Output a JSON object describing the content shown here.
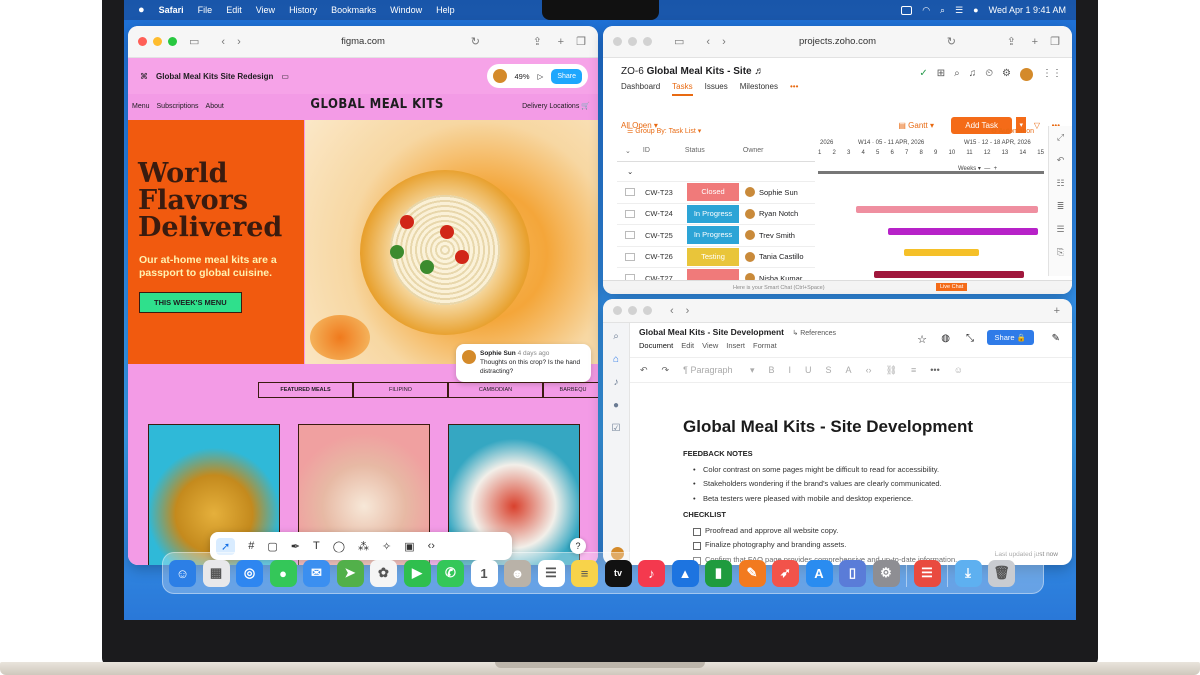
{
  "menubar": {
    "apple": "",
    "items": [
      "Safari",
      "File",
      "Edit",
      "View",
      "History",
      "Bookmarks",
      "Window",
      "Help"
    ],
    "datetime": "Wed Apr 1  9:41 AM"
  },
  "figma": {
    "url": "figma.com",
    "project": "Global Meal Kits Site Redesign",
    "zoom": "49%",
    "share": "Share",
    "site": {
      "nav": [
        "Menu",
        "Subscriptions",
        "About"
      ],
      "logo": "GLOBAL MEAL KITS",
      "delivery": "Delivery Locations",
      "hero_title": "World Flavors Delivered",
      "hero_sub": "Our at-home meal kits are a passport to global cuisine.",
      "cta": "THIS WEEK'S MENU",
      "featured": [
        "FEATURED MEALS",
        "FILIPINO",
        "CAMBODIAN",
        "BARBEQU"
      ]
    },
    "comment": {
      "author": "Sophie Sun",
      "time": "4 days ago",
      "text": "Thoughts on this crop? Is the hand distracting?"
    },
    "help": "?"
  },
  "zoho": {
    "url": "projects.zoho.com",
    "code": "ZO-6",
    "title": "Global Meal Kits - Site",
    "tabs": [
      "Dashboard",
      "Tasks",
      "Issues",
      "Milestones",
      "•••"
    ],
    "filter": "All Open",
    "view": "Gantt",
    "add_task": "Add Task",
    "group_by": "Group By: Task List",
    "automation": "Automation",
    "columns": [
      "ID",
      "Status",
      "Owner"
    ],
    "gantt_header": {
      "year": "2026",
      "w14": "W14 · 05 - 11 APR, 2026",
      "w15": "W15 · 12 - 18 APR, 2026",
      "days": [
        "1",
        "2",
        "3",
        "4",
        "5",
        "6",
        "7",
        "8",
        "9",
        "10",
        "11",
        "12",
        "13",
        "14",
        "15"
      ],
      "scale": "Weeks"
    },
    "rows": [
      {
        "id": "CW-T23",
        "status": "Closed",
        "status_color": "#f07a7a",
        "owner": "Sophie Sun",
        "bar_color": "#ef8fa0"
      },
      {
        "id": "CW-T24",
        "status": "In Progress",
        "status_color": "#2ca4d6",
        "owner": "Ryan Notch",
        "bar_color": "#b722c8"
      },
      {
        "id": "CW-T25",
        "status": "In Progress",
        "status_color": "#2ca4d6",
        "owner": "Trev Smith",
        "bar_color": "#f5c028"
      },
      {
        "id": "CW-T26",
        "status": "Testing",
        "status_color": "#e9c53a",
        "owner": "Tania Castillo",
        "bar_color": "#a0173c"
      },
      {
        "id": "CW-T27",
        "status": "",
        "status_color": "#f07a7a",
        "owner": "Nisha Kumar",
        "bar_color": "#e86a12"
      }
    ],
    "footer_chat": "Here is your Smart Chat (Ctrl+Space)",
    "live_chat": "Live Chat"
  },
  "doc": {
    "title_bar": "Global Meal Kits - Site Development",
    "references": "References",
    "menu": [
      "Document",
      "Edit",
      "View",
      "Insert",
      "Format"
    ],
    "share": "Share",
    "paragraph": "Paragraph",
    "heading": "Global Meal Kits - Site Development",
    "feedback_label": "FEEDBACK NOTES",
    "feedback": [
      "Color contrast on some pages might be difficult to read for accessibility.",
      "Stakeholders wondering if the brand's values are clearly communicated.",
      "Beta testers were pleased with mobile and desktop experience."
    ],
    "checklist_label": "CHECKLIST",
    "checklist": [
      "Proofread and approve all website copy.",
      "Finalize photography and branding assets.",
      "Confirm that FAQ page provides comprehensive and up-to-date information."
    ],
    "updated": "Last updated just now"
  },
  "dock": {
    "apps": [
      {
        "name": "Finder",
        "color": "#2c7fe6",
        "glyph": "☺"
      },
      {
        "name": "Launchpad",
        "color": "#e8e8ea",
        "glyph": "▦"
      },
      {
        "name": "Safari",
        "color": "#2e86f0",
        "glyph": "◎"
      },
      {
        "name": "Messages",
        "color": "#34c759",
        "glyph": "●"
      },
      {
        "name": "Mail",
        "color": "#3b8ff0",
        "glyph": "✉"
      },
      {
        "name": "Maps",
        "color": "#52b04a",
        "glyph": "➤"
      },
      {
        "name": "Photos",
        "color": "#f5f5f5",
        "glyph": "✿"
      },
      {
        "name": "FaceTime",
        "color": "#2fbf4e",
        "glyph": "▶"
      },
      {
        "name": "Phone",
        "color": "#34c759",
        "glyph": "✆"
      },
      {
        "name": "Calendar",
        "color": "#ffffff",
        "glyph": "1"
      },
      {
        "name": "Contacts",
        "color": "#b9b2a8",
        "glyph": "☻"
      },
      {
        "name": "Reminders",
        "color": "#ffffff",
        "glyph": "☰"
      },
      {
        "name": "Notes",
        "color": "#f8d34a",
        "glyph": "≡"
      },
      {
        "name": "TV",
        "color": "#111111",
        "glyph": "tv"
      },
      {
        "name": "Music",
        "color": "#f4394e",
        "glyph": "♪"
      },
      {
        "name": "Keynote",
        "color": "#1d74e0",
        "glyph": "▲"
      },
      {
        "name": "Numbers",
        "color": "#1f9b3e",
        "glyph": "▮"
      },
      {
        "name": "Pages",
        "color": "#f27a1f",
        "glyph": "✎"
      },
      {
        "name": "Rocket",
        "color": "#f2534a",
        "glyph": "➶"
      },
      {
        "name": "App Store",
        "color": "#2a8cf0",
        "glyph": "A"
      },
      {
        "name": "iPhone Mirroring",
        "color": "#5a7cd8",
        "glyph": "▯"
      },
      {
        "name": "System Settings",
        "color": "#8e8e93",
        "glyph": "⚙"
      },
      {
        "name": "Zoho",
        "color": "#e94a3f",
        "glyph": "☰"
      },
      {
        "name": "Downloads",
        "color": "#5eb0f0",
        "glyph": "⤓"
      },
      {
        "name": "Trash",
        "color": "#c9ccd1",
        "glyph": "🗑"
      }
    ]
  },
  "colors": {
    "accent_orange": "#f46b18",
    "figma_pink": "#f39be6",
    "hero_orange": "#f15a0f",
    "doc_blue": "#2f7be8"
  }
}
